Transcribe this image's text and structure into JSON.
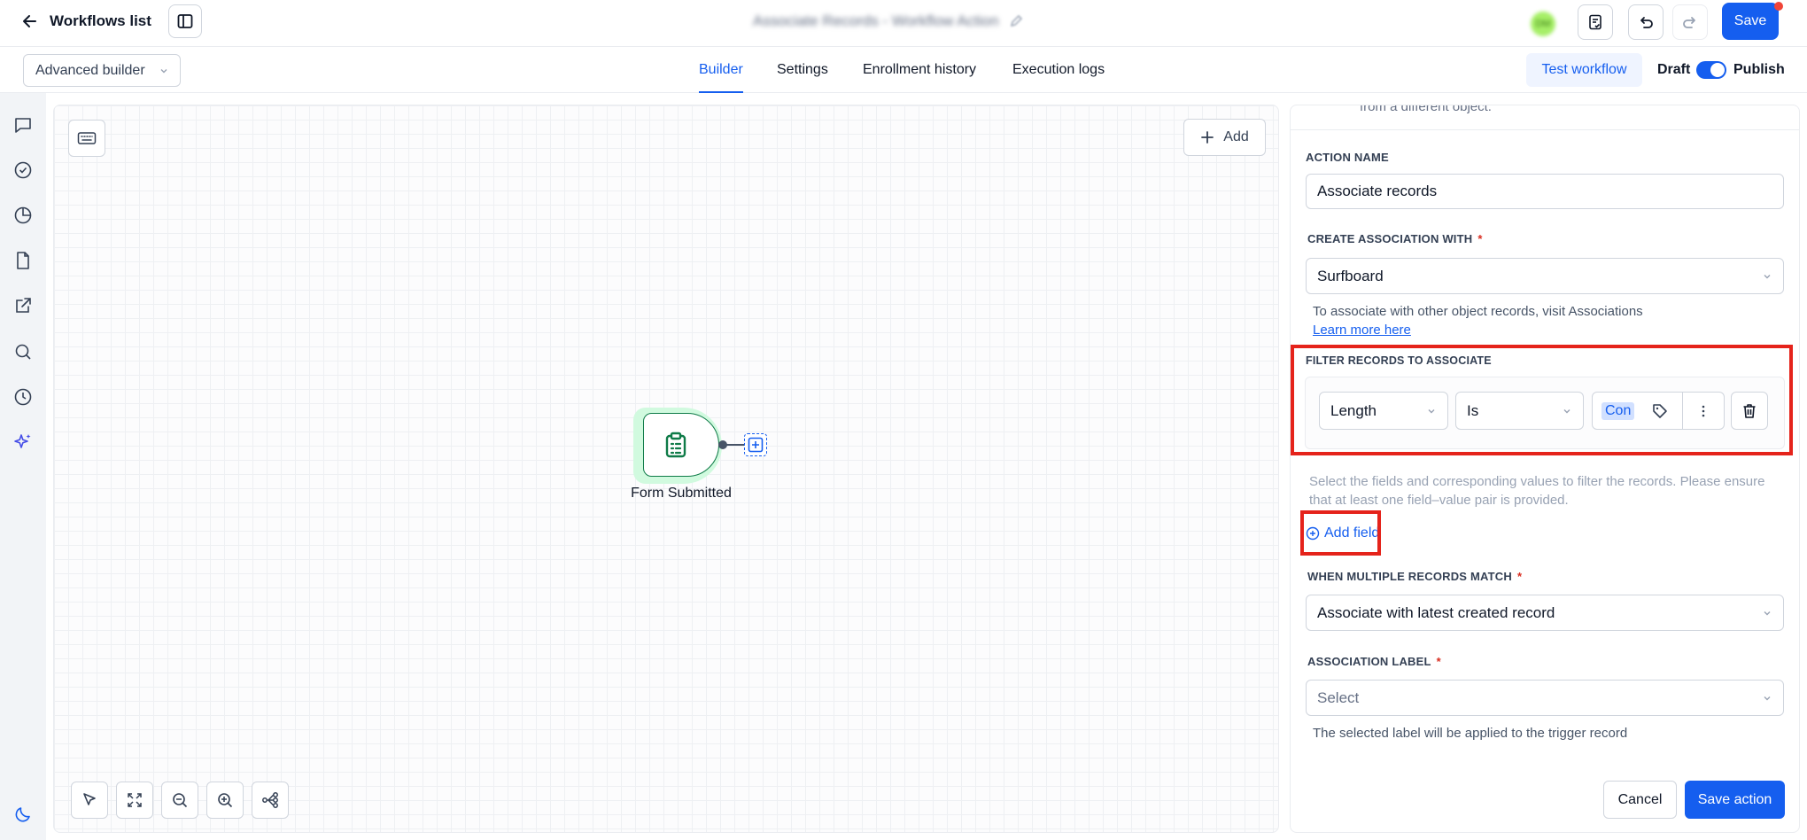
{
  "header": {
    "back_label": "Workflows list",
    "title": "Associate Records - Workflow Action",
    "avatar_initials": "DM",
    "save_label": "Save"
  },
  "subheader": {
    "builder_mode": "Advanced builder",
    "tabs": [
      {
        "label": "Builder",
        "active": true
      },
      {
        "label": "Settings",
        "active": false
      },
      {
        "label": "Enrollment history",
        "active": false
      },
      {
        "label": "Execution logs",
        "active": false
      }
    ],
    "test_label": "Test workflow",
    "draft_label": "Draft",
    "publish_label": "Publish",
    "publish_on": true
  },
  "canvas": {
    "add_label": "Add",
    "node_label": "Form Submitted"
  },
  "panel": {
    "top_fragment": "from a different object.",
    "action_name_label": "ACTION NAME",
    "action_name_value": "Associate records",
    "create_assoc_label": "CREATE ASSOCIATION WITH",
    "create_assoc_value": "Surfboard",
    "assoc_hint": "To associate with other object records, visit Associations",
    "learn_more": "Learn more here",
    "filter_label": "FILTER RECORDS TO ASSOCIATE",
    "filter_field": "Length",
    "filter_operator": "Is",
    "filter_value": "Con",
    "filter_hint": "Select the fields and corresponding values to filter the records. Please ensure that at least one field–value pair is provided.",
    "add_field_label": "Add field",
    "multi_match_label": "WHEN MULTIPLE RECORDS MATCH",
    "multi_match_value": "Associate with latest created record",
    "assoc_label_label": "ASSOCIATION LABEL",
    "assoc_label_placeholder": "Select",
    "assoc_label_hint": "The selected label will be applied to the trigger record",
    "cancel_label": "Cancel",
    "save_action_label": "Save action"
  },
  "colors": {
    "primary": "#155eef",
    "node_green": "#0f7b48",
    "highlight_red": "#e5231b"
  }
}
